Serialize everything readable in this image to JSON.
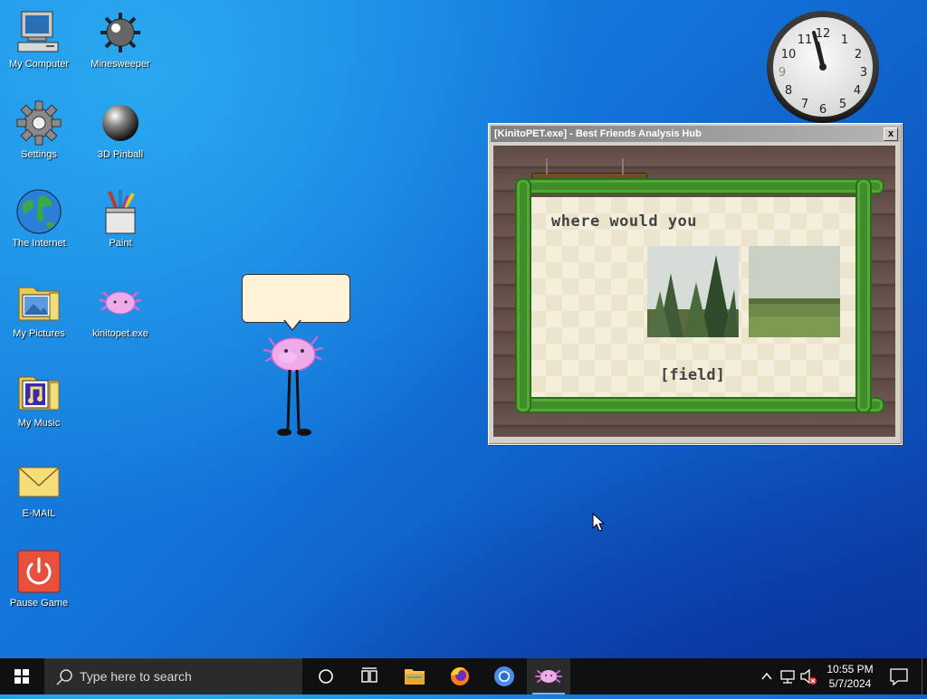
{
  "desktop_icons": [
    {
      "label": "My Computer",
      "icon": "computer-icon"
    },
    {
      "label": "Minesweeper",
      "icon": "mine-icon"
    },
    {
      "label": "Settings",
      "icon": "gear-icon"
    },
    {
      "label": "3D Pinball",
      "icon": "pinball-icon"
    },
    {
      "label": "The Internet",
      "icon": "globe-icon"
    },
    {
      "label": "Paint",
      "icon": "paint-icon"
    },
    {
      "label": "My Pictures",
      "icon": "pictures-folder-icon"
    },
    {
      "label": "kinitopet.exe",
      "icon": "axolotl-icon"
    },
    {
      "label": "My Music",
      "icon": "music-folder-icon"
    },
    {
      "label": "E-MAIL",
      "icon": "envelope-icon"
    },
    {
      "label": "Pause Game",
      "icon": "power-icon"
    }
  ],
  "window": {
    "title": "[KinitoPET.exe] - Best Friends Analysis Hub",
    "close_label": "x",
    "question": "where would you",
    "answer": "[field]"
  },
  "taskbar": {
    "search_placeholder": "Type here to search",
    "time": "10:55 PM",
    "date": "5/7/2024"
  },
  "colors": {
    "titlebar_inactive": "#808080",
    "vine_green": "#3e8e2a",
    "board_cream": "#f4eedc",
    "wood": "#5e4a45",
    "pet_pink": "#e9a6e6"
  }
}
